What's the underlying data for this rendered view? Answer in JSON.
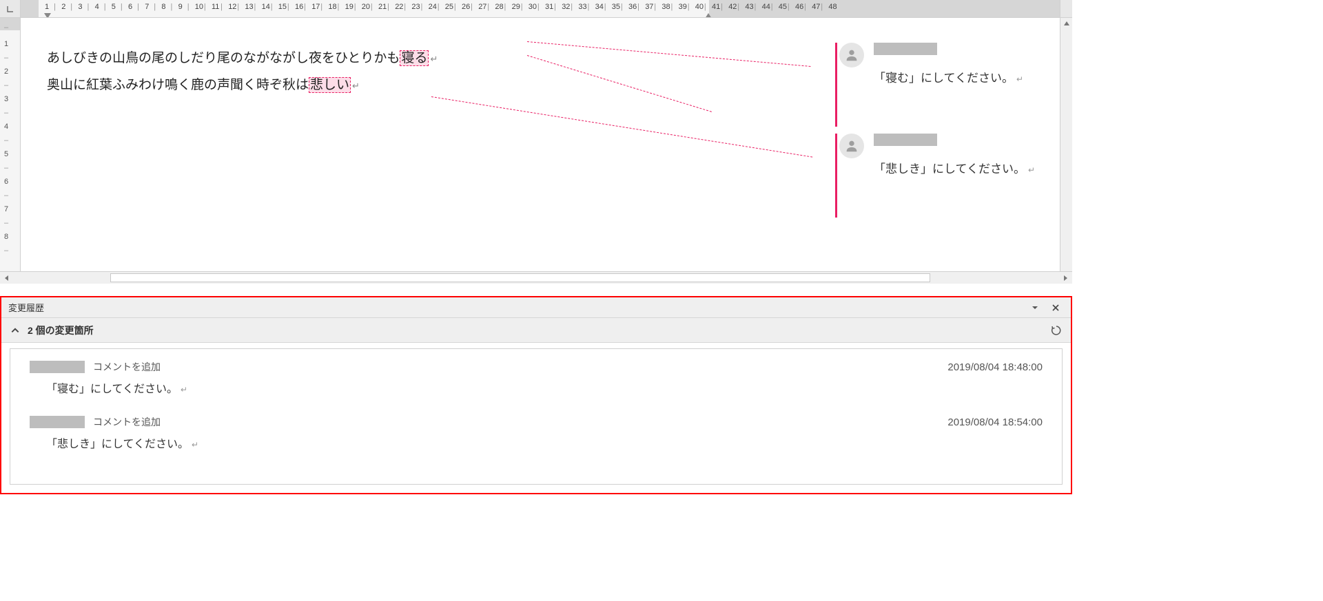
{
  "ruler": {
    "h_start_shaded_end": 1,
    "h_mid_shaded_start": 41,
    "h_numbers_max": 48,
    "v_numbers_visible": [
      "1",
      "2",
      "3",
      "4",
      "5",
      "6",
      "7",
      "8"
    ]
  },
  "document": {
    "paragraphs": [
      {
        "pre": "あしびきの山鳥の尾のしだり尾のながながし夜をひとりかも",
        "highlighted": "寝る",
        "post": ""
      },
      {
        "pre": "奥山に紅葉ふみわけ鳴く鹿の声聞く時ぞ秋は",
        "highlighted": "悲しい",
        "post": ""
      }
    ],
    "pilcrow": "↵"
  },
  "comments": [
    {
      "text": "「寝む」にしてください。"
    },
    {
      "text": "「悲しき」にしてください。"
    }
  ],
  "revisions": {
    "title": "変更履歴",
    "summary": "2 個の変更箇所",
    "items": [
      {
        "action": "コメントを追加",
        "timestamp": "2019/08/04 18:48:00",
        "body": "「寝む」にしてください。"
      },
      {
        "action": "コメントを追加",
        "timestamp": "2019/08/04 18:54:00",
        "body": "「悲しき」にしてください。"
      }
    ]
  }
}
